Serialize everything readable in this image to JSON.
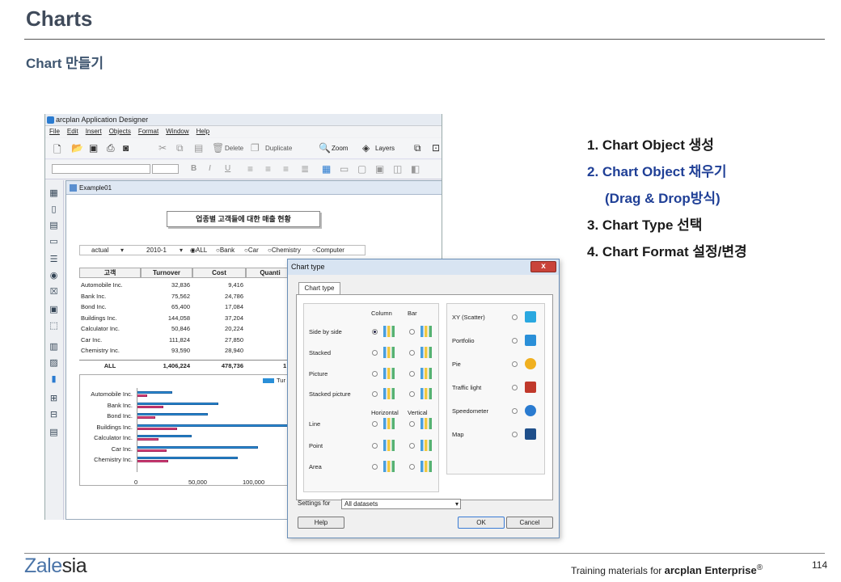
{
  "page": {
    "title": "Charts",
    "subtitle": "Chart 만들기",
    "steps": [
      "1. Chart Object 생성",
      "2. Chart Object 채우기",
      "(Drag & Drop방식)",
      "3. Chart Type 선택",
      "4. Chart Format 설정/변경"
    ],
    "footer": {
      "logo_a": "Zale",
      "logo_b": "sia",
      "training_prefix": "Training  materials for ",
      "training_product": "arcplan Enterprise",
      "reg": "®",
      "page_number": "114"
    },
    "colors": {
      "title": "#3f4a5a",
      "step_blue": "#1f3f96",
      "logo": "#4a74a8"
    }
  },
  "designer": {
    "window_title": "arcplan Application Designer",
    "menu": [
      "File",
      "Edit",
      "Insert",
      "Objects",
      "Format",
      "Window",
      "Help"
    ],
    "toolbar": {
      "delete": "Delete",
      "duplicate": "Duplicate",
      "zoom": "Zoom",
      "layers": "Layers"
    },
    "example": {
      "title": "Example01",
      "report_header": "업종별 고객들에 대한 매출 현황",
      "filter": {
        "actual": "actual",
        "period": "2010-1",
        "options": [
          "ALL",
          "Bank",
          "Car",
          "Chemistry",
          "Computer"
        ]
      },
      "columns": [
        "고객",
        "Turnover",
        "Cost",
        "Quanti"
      ],
      "rows": [
        [
          "Automobile Inc.",
          "32,836",
          "9,416"
        ],
        [
          "Bank Inc.",
          "75,562",
          "24,786"
        ],
        [
          "Bond Inc.",
          "65,400",
          "17,084"
        ],
        [
          "Buildings Inc.",
          "144,058",
          "37,204"
        ],
        [
          "Calculator Inc.",
          "50,846",
          "20,224"
        ],
        [
          "Car Inc.",
          "111,824",
          "27,850"
        ],
        [
          "Chemistry Inc.",
          "93,590",
          "28,940"
        ]
      ],
      "total": [
        "ALL",
        "1,406,224",
        "478,736",
        "1"
      ],
      "legend_partial": "Tur",
      "chart_categories": [
        "Automobile Inc.",
        "Bank Inc.",
        "Bond Inc.",
        "Buildings Inc.",
        "Calculator Inc.",
        "Car Inc.",
        "Chemistry Inc."
      ],
      "chart_turnover": [
        32836,
        75562,
        65400,
        144058,
        50846,
        111824,
        93590
      ],
      "chart_cost": [
        9416,
        24786,
        17084,
        37204,
        20224,
        27850,
        28940
      ],
      "chart_ticks": [
        "0",
        "50,000",
        "100,000"
      ],
      "chart_max": 100000
    }
  },
  "dialog": {
    "title": "Chart type",
    "close": "x",
    "tab": "Chart type",
    "col_headers": {
      "column": "Column",
      "bar": "Bar",
      "horizontal": "Horizontal",
      "vertical": "Vertical"
    },
    "left_options": [
      "Side by side",
      "Stacked",
      "Picture",
      "Stacked picture",
      "Line",
      "Point",
      "Area"
    ],
    "right_options": [
      "XY (Scatter)",
      "Portfolio",
      "Pie",
      "Traffic light",
      "Speedometer",
      "Map"
    ],
    "settings_label": "Settings for",
    "dataset": "All datasets",
    "help": "Help",
    "ok": "OK",
    "cancel": "Cancel"
  }
}
